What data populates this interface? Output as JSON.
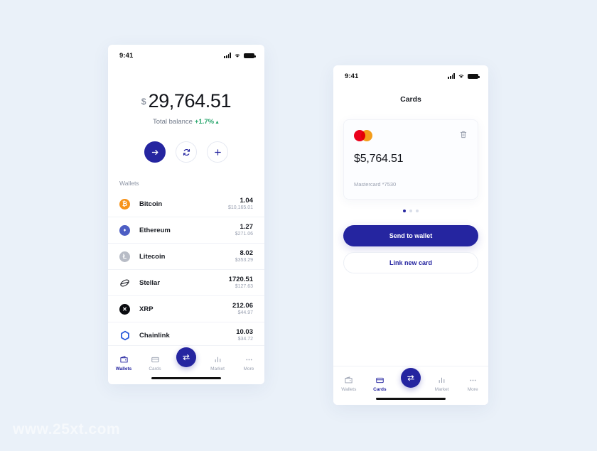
{
  "theme": {
    "background": "#eaf1f9",
    "accent": "#2525a0",
    "positive": "#2aa66d",
    "muted": "#9aa1b1"
  },
  "watermark": "www.25xt.com",
  "wallets_screen": {
    "status_bar": {
      "time": "9:41"
    },
    "balance": {
      "currency_symbol": "$",
      "amount": "29,764.51",
      "label": "Total balance",
      "change": "+1.7%",
      "caret": "▲"
    },
    "actions": [
      {
        "name": "send-button",
        "icon": "arrow-right-icon",
        "glyph": "→"
      },
      {
        "name": "swap-button",
        "icon": "refresh-icon",
        "glyph": "↻"
      },
      {
        "name": "add-button",
        "icon": "plus-icon",
        "glyph": "+"
      }
    ],
    "section_title": "Wallets",
    "wallets": [
      {
        "name": "Bitcoin",
        "symbol": "₿",
        "amount": "1.04",
        "fiat": "$10,165.01",
        "color": "#f7931a",
        "icon": "bitcoin-icon"
      },
      {
        "name": "Ethereum",
        "symbol": "♦",
        "amount": "1.27",
        "fiat": "$271.06",
        "color": "#4d5ec4",
        "icon": "ethereum-icon"
      },
      {
        "name": "Litecoin",
        "symbol": "Ł",
        "amount": "8.02",
        "fiat": "$353.29",
        "color": "#b8bcc6",
        "icon": "litecoin-icon"
      },
      {
        "name": "Stellar",
        "symbol": "",
        "amount": "1720.51",
        "fiat": "$127.63",
        "color": "#22242b",
        "icon": "stellar-icon"
      },
      {
        "name": "XRP",
        "symbol": "✕",
        "amount": "212.06",
        "fiat": "$44.97",
        "color": "#0b0c10",
        "icon": "xrp-icon"
      },
      {
        "name": "Chainlink",
        "symbol": "",
        "amount": "10.03",
        "fiat": "$34.72",
        "color": "#2a5ada",
        "icon": "chainlink-icon"
      }
    ],
    "nav": [
      {
        "label": "Wallets",
        "icon": "wallet-icon",
        "active": true
      },
      {
        "label": "Cards",
        "icon": "card-icon",
        "active": false
      },
      {
        "label": "",
        "icon": "swap-icon",
        "active": false
      },
      {
        "label": "Market",
        "icon": "market-icon",
        "active": false
      },
      {
        "label": "More",
        "icon": "more-icon",
        "active": false
      }
    ]
  },
  "cards_screen": {
    "status_bar": {
      "time": "9:41"
    },
    "title": "Cards",
    "card": {
      "brand_icon": "mastercard-icon",
      "delete_icon": "trash-icon",
      "amount": "$5,764.51",
      "meta": "Mastercard *7530"
    },
    "pager": {
      "count": 3,
      "active_index": 0
    },
    "buttons": {
      "primary": "Send to wallet",
      "secondary": "Link new card"
    },
    "nav": [
      {
        "label": "Wallets",
        "icon": "wallet-icon",
        "active": false
      },
      {
        "label": "Cards",
        "icon": "card-icon",
        "active": true
      },
      {
        "label": "",
        "icon": "swap-icon",
        "active": false
      },
      {
        "label": "Market",
        "icon": "market-icon",
        "active": false
      },
      {
        "label": "More",
        "icon": "more-icon",
        "active": false
      }
    ]
  }
}
